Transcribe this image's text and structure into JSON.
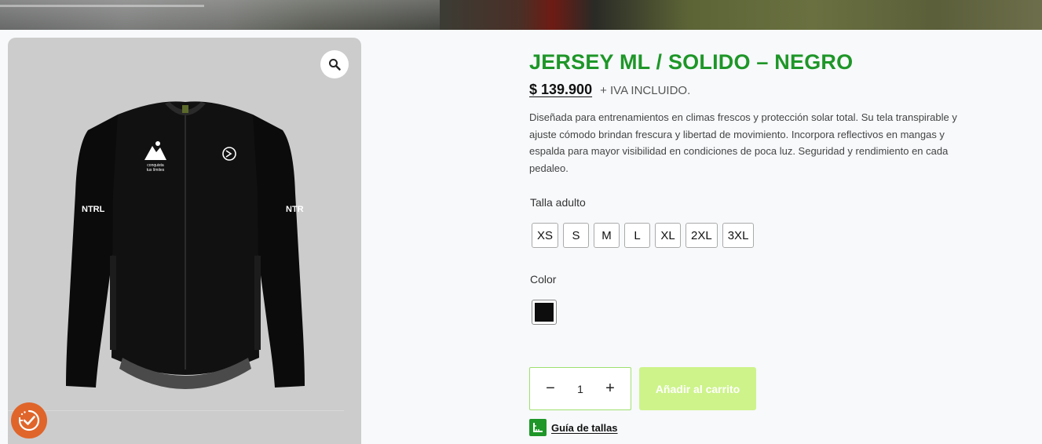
{
  "product": {
    "title": "JERSEY ML / SOLIDO – NEGRO",
    "price": "$ 139.900",
    "tax_note": "+ IVA INCLUIDO.",
    "description": "Diseñada para entrenamientos en climas frescos y protección solar total. Su tela transpirable y ajuste cómodo brindan frescura y libertad de movimiento. Incorpora reflectivos en mangas y espalda para mayor visibilidad en condiciones de poca luz. Seguridad y rendimiento en cada pedaleo."
  },
  "size_selector": {
    "label": "Talla adulto",
    "options": [
      "XS",
      "S",
      "M",
      "L",
      "XL",
      "2XL",
      "3XL"
    ]
  },
  "color_selector": {
    "label": "Color",
    "swatch_color": "#0d0d0d"
  },
  "cart": {
    "quantity": "1",
    "minus_symbol": "−",
    "plus_symbol": "+",
    "add_label": "Añadir al carrito"
  },
  "size_guide": {
    "label": "Guía de tallas"
  },
  "jersey_print": {
    "sleeve_text_left": "NTRL",
    "sleeve_text_right": "NTR",
    "chest_logo_line1": "conquista",
    "chest_logo_line2": "tus límites"
  },
  "icons": {
    "zoom": "magnifier-icon",
    "badge": "checkmark-clock-icon",
    "guide": "ruler-icon"
  },
  "colors": {
    "title_green": "#1e9628",
    "cart_button": "#cdf38a",
    "qty_border": "#9fe06e",
    "badge_orange": "#e0652a"
  }
}
